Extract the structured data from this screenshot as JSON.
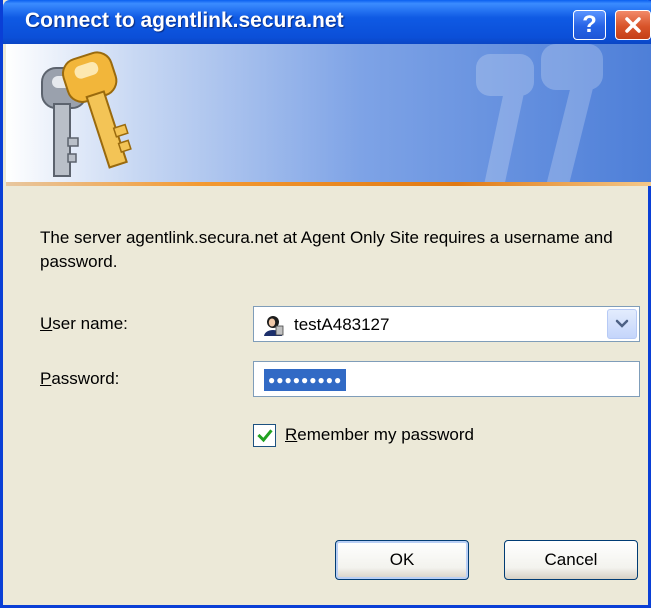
{
  "window": {
    "title": "Connect to agentlink.secura.net",
    "help_label": "?",
    "colors": {
      "titlebar": "#0b4fd8",
      "close": "#d8542a",
      "face": "#ece9d8",
      "accent_line": "#f39a32",
      "selection": "#316ac5"
    }
  },
  "banner": {
    "icon": "keys-icon",
    "watermark": "keys-watermark-icon"
  },
  "message": "The server agentlink.secura.net at Agent Only Site requires a username and password.",
  "form": {
    "username_label_key": "U",
    "username_label_rest": "ser name:",
    "username_value": "testA483127",
    "username_icon": "user-icon",
    "password_label_key": "P",
    "password_label_rest": "assword:",
    "password_mask": "●●●●●●●●●",
    "remember_key": "R",
    "remember_rest": "emember my password",
    "remember_checked": true
  },
  "buttons": {
    "ok": "OK",
    "cancel": "Cancel"
  }
}
